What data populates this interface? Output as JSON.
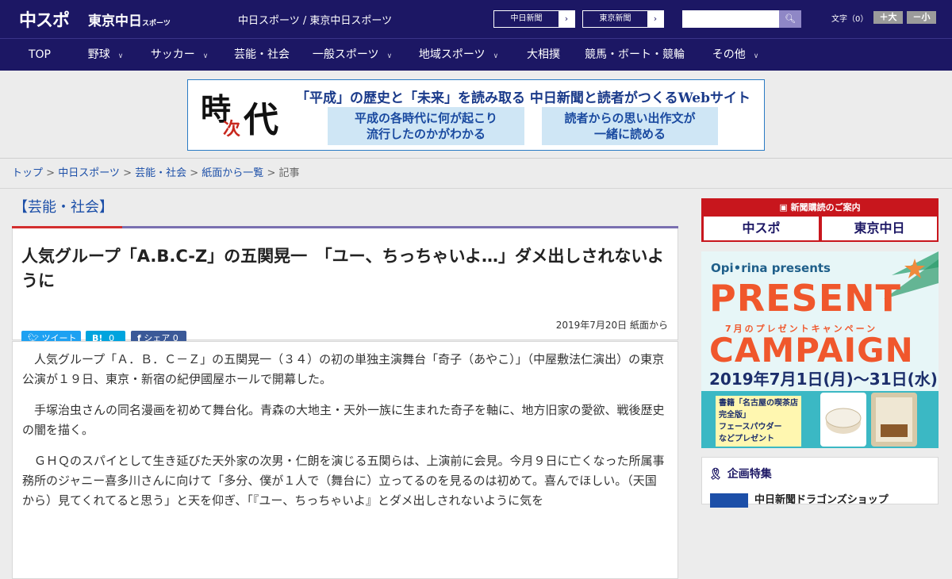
{
  "header": {
    "logo_main": "中スポ",
    "logo_tokyo": "東京中日",
    "logo_tokyo_small": "スポーツ",
    "site_title": "中日スポーツ / 東京中日スポーツ",
    "site_buttons": [
      "中日新聞",
      "東京新聞"
    ],
    "font_label": "文字（0）",
    "font_plus": "＋大",
    "font_minus": "－小"
  },
  "nav": [
    {
      "label": "TOP",
      "dropdown": false
    },
    {
      "label": "野球",
      "dropdown": true
    },
    {
      "label": "サッカー",
      "dropdown": true
    },
    {
      "label": "芸能・社会",
      "dropdown": false
    },
    {
      "label": "一般スポーツ",
      "dropdown": true
    },
    {
      "label": "地域スポーツ",
      "dropdown": true
    },
    {
      "label": "大相撲",
      "dropdown": false
    },
    {
      "label": "競馬・ボート・競輪",
      "dropdown": false
    },
    {
      "label": "その他",
      "dropdown": true
    }
  ],
  "banner": {
    "kanji_a": "時",
    "kanji_b": "次",
    "kanji_c": "代",
    "headline": "「平成」の歴史と「未来」を読み取る 中日新聞と読者がつくるWebサイト",
    "box_left": [
      "平成の各時代に何が起こり",
      "流行したのかがわかる"
    ],
    "box_right": [
      "読者からの思い出作文が",
      "一緒に読める"
    ]
  },
  "breadcrumb": [
    {
      "label": "トップ",
      "link": true
    },
    {
      "label": "中日スポーツ",
      "link": true
    },
    {
      "label": "芸能・社会",
      "link": true
    },
    {
      "label": "紙面から一覧",
      "link": true
    },
    {
      "label": "記事",
      "link": false
    }
  ],
  "article": {
    "category": "【芸能・社会】",
    "title": "人気グループ「A.B.C-Z」の五関晃一　「ユー、ちっちゃいよ…」ダメ出しされないように",
    "share": {
      "tweet": "ツイート",
      "hatena": "B!",
      "hatena_count": "0",
      "facebook": "シェア",
      "facebook_count": "0"
    },
    "date": "2019年7月20日 紙面から",
    "paragraphs": [
      "人気グループ「Ａ．Ｂ．Ｃ－Ｚ」の五関晃一（３４）の初の単独主演舞台「奇子（あやこ）」（中屋敷法仁演出）の東京公演が１９日、東京・新宿の紀伊國屋ホールで開幕した。",
      "手塚治虫さんの同名漫画を初めて舞台化。青森の大地主・天外一族に生まれた奇子を軸に、地方旧家の愛欲、戦後歴史の闇を描く。",
      "ＧＨＱのスパイとして生き延びた天外家の次男・仁朗を演じる五関らは、上演前に会見。今月９日に亡くなった所属事務所のジャニー喜多川さんに向けて「多分、僕が１人で（舞台に）立ってるのを見るのは初めて。喜んでほしい。（天国から）見てくれてると思う」と天を仰ぎ、「『ユー、ちっちゃいよ』とダメ出しされないように気を"
    ]
  },
  "sidebar": {
    "subscribe_title": "新聞購読のご案内",
    "subscribe_left": "中スポ",
    "subscribe_right": "東京中日",
    "present": {
      "brand": "Opi•rina presents",
      "line1": "PRESENT",
      "subline": "7月のプレゼントキャンペーン",
      "line2": "CAMPAIGN",
      "dates": "2019年7月1日(月)〜31日(水)",
      "note": [
        "書籍「名古屋の喫茶店",
        "完全版」",
        "フェースパウダー",
        "などプレゼント"
      ]
    },
    "kikaku_title": "企画特集",
    "kikaku_item": "中日新聞ドラゴンズショップ"
  }
}
